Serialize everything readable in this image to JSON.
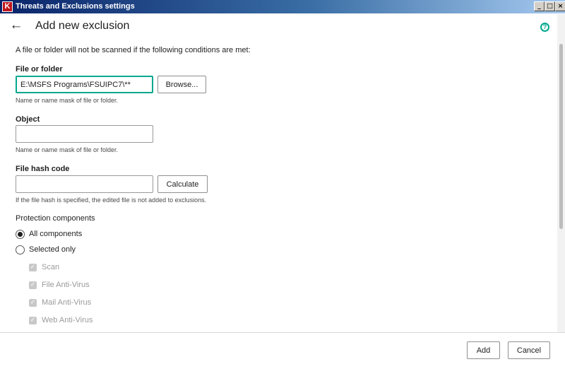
{
  "window": {
    "title": "Threats and Exclusions settings",
    "app_icon_glyph": "K",
    "controls": {
      "minimize": "_",
      "maximize": "□",
      "close": "×"
    }
  },
  "header": {
    "back_glyph": "←",
    "title": "Add new exclusion",
    "help_glyph": "?"
  },
  "intro": "A file or folder will not be scanned if the following conditions are met:",
  "file_or_folder": {
    "label": "File or folder",
    "value": "E:\\MSFS Programs\\FSUIPC7\\**",
    "browse_label": "Browse...",
    "hint": "Name or name mask of file or folder."
  },
  "object": {
    "label": "Object",
    "value": "",
    "hint": "Name or name mask of file or folder."
  },
  "file_hash": {
    "label": "File hash code",
    "value": "",
    "calculate_label": "Calculate",
    "hint": "If the file hash is specified, the edited file is not added to exclusions."
  },
  "protection": {
    "label": "Protection components",
    "options": [
      {
        "label": "All components",
        "checked": true
      },
      {
        "label": "Selected only",
        "checked": false
      }
    ],
    "components": [
      {
        "label": "Scan",
        "checked": true
      },
      {
        "label": "File Anti-Virus",
        "checked": true
      },
      {
        "label": "Mail Anti-Virus",
        "checked": true
      },
      {
        "label": "Web Anti-Virus",
        "checked": true
      }
    ],
    "check_glyph": "✓"
  },
  "footer": {
    "add_label": "Add",
    "cancel_label": "Cancel"
  },
  "colors": {
    "accent": "#00a88e",
    "titlebar_start": "#0a246a",
    "titlebar_end": "#a6caf0",
    "disabled_text": "#9a9a9a"
  }
}
